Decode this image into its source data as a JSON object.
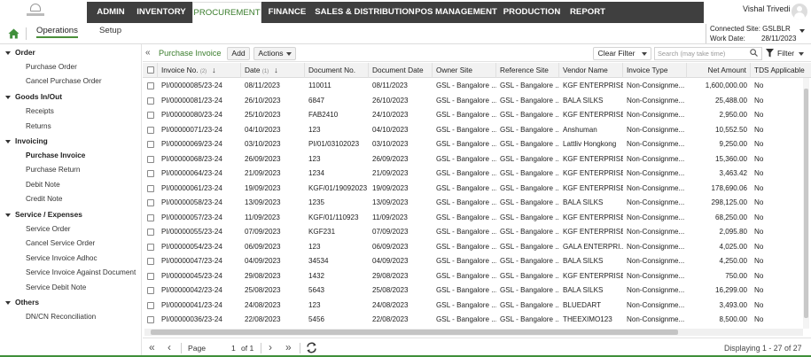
{
  "top_nav": {
    "items": [
      {
        "label": "ADMIN"
      },
      {
        "label": "INVENTORY"
      },
      {
        "label": "PROCUREMENT"
      },
      {
        "label": "FINANCE"
      },
      {
        "label": "SALES & DISTRIBUTION"
      },
      {
        "label": "POS MANAGEMENT"
      },
      {
        "label": "PRODUCTION"
      },
      {
        "label": "REPORT"
      }
    ],
    "active_index": 2,
    "user_name": "Vishal Trivedi"
  },
  "sub_nav": {
    "tabs": [
      {
        "label": "Operations"
      },
      {
        "label": "Setup"
      }
    ],
    "connected_site_label": "Connected Site:",
    "connected_site_value": "GSLBLR",
    "work_date_label": "Work Date:",
    "work_date_value": "28/11/2023"
  },
  "sidebar": {
    "groups": [
      {
        "label": "Order",
        "items": [
          {
            "label": "Purchase Order"
          },
          {
            "label": "Cancel Purchase Order"
          }
        ]
      },
      {
        "label": "Goods In/Out",
        "items": [
          {
            "label": "Receipts"
          },
          {
            "label": "Returns"
          }
        ]
      },
      {
        "label": "Invoicing",
        "items": [
          {
            "label": "Purchase Invoice",
            "active": true
          },
          {
            "label": "Purchase Return"
          },
          {
            "label": "Debit Note"
          },
          {
            "label": "Credit Note"
          }
        ]
      },
      {
        "label": "Service / Expenses",
        "items": [
          {
            "label": "Service Order"
          },
          {
            "label": "Cancel Service Order"
          },
          {
            "label": "Service Invoice Adhoc"
          },
          {
            "label": "Service Invoice Against Document"
          },
          {
            "label": "Service Debit Note"
          }
        ]
      },
      {
        "label": "Others",
        "items": [
          {
            "label": "DN/CN Reconciliation"
          }
        ]
      }
    ]
  },
  "toolbar": {
    "breadcrumb": "Purchase Invoice",
    "add_label": "Add",
    "actions_label": "Actions",
    "clear_filter_label": "Clear Filter",
    "search_placeholder": "Search (may take time)",
    "filter_label": "Filter"
  },
  "grid": {
    "columns": [
      {
        "label": "Invoice No.",
        "suffix": "(2)",
        "sorted": true
      },
      {
        "label": "Date",
        "suffix": "(1)",
        "sorted": true
      },
      {
        "label": "Document No."
      },
      {
        "label": "Document Date"
      },
      {
        "label": "Owner Site"
      },
      {
        "label": "Reference Site"
      },
      {
        "label": "Vendor Name"
      },
      {
        "label": "Invoice Type"
      },
      {
        "label": "Net Amount"
      },
      {
        "label": "TDS Applicable"
      }
    ],
    "rows": [
      [
        "PI/00000085/23-24",
        "08/11/2023",
        "110011",
        "08/11/2023",
        "GSL - Bangalore ...",
        "GSL - Bangalore ...",
        "KGF ENTERPRISES",
        "Non-Consignme...",
        "1,600,000.00",
        "No"
      ],
      [
        "PI/00000081/23-24",
        "26/10/2023",
        "6847",
        "26/10/2023",
        "GSL - Bangalore ...",
        "GSL - Bangalore ...",
        "BALA SILKS",
        "Non-Consignme...",
        "25,488.00",
        "No"
      ],
      [
        "PI/00000080/23-24",
        "25/10/2023",
        "FAB2410",
        "24/10/2023",
        "GSL - Bangalore ...",
        "GSL - Bangalore ...",
        "KGF ENTERPRISES",
        "Non-Consignme...",
        "2,950.00",
        "No"
      ],
      [
        "PI/00000071/23-24",
        "04/10/2023",
        "123",
        "04/10/2023",
        "GSL - Bangalore ...",
        "GSL - Bangalore ...",
        "Anshuman",
        "Non-Consignme...",
        "10,552.50",
        "No"
      ],
      [
        "PI/00000069/23-24",
        "03/10/2023",
        "PI/01/03102023",
        "03/10/2023",
        "GSL - Bangalore ...",
        "GSL - Bangalore ...",
        "Lattliv Hongkong",
        "Non-Consignme...",
        "9,250.00",
        "No"
      ],
      [
        "PI/00000068/23-24",
        "26/09/2023",
        "123",
        "26/09/2023",
        "GSL - Bangalore ...",
        "GSL - Bangalore ...",
        "KGF ENTERPRISES",
        "Non-Consignme...",
        "15,360.00",
        "No"
      ],
      [
        "PI/00000064/23-24",
        "21/09/2023",
        "1234",
        "21/09/2023",
        "GSL - Bangalore ...",
        "GSL - Bangalore ...",
        "KGF ENTERPRISES",
        "Non-Consignme...",
        "3,463.42",
        "No"
      ],
      [
        "PI/00000061/23-24",
        "19/09/2023",
        "KGF/01/19092023",
        "19/09/2023",
        "GSL - Bangalore ...",
        "GSL - Bangalore ...",
        "KGF ENTERPRISES",
        "Non-Consignme...",
        "178,690.06",
        "No"
      ],
      [
        "PI/00000058/23-24",
        "13/09/2023",
        "1235",
        "13/09/2023",
        "GSL - Bangalore ...",
        "GSL - Bangalore ...",
        "BALA SILKS",
        "Non-Consignme...",
        "298,125.00",
        "No"
      ],
      [
        "PI/00000057/23-24",
        "11/09/2023",
        "KGF/01/110923",
        "11/09/2023",
        "GSL - Bangalore ...",
        "GSL - Bangalore ...",
        "KGF ENTERPRISES",
        "Non-Consignme...",
        "68,250.00",
        "No"
      ],
      [
        "PI/00000055/23-24",
        "07/09/2023",
        "KGF231",
        "07/09/2023",
        "GSL - Bangalore ...",
        "GSL - Bangalore ...",
        "KGF ENTERPRISES",
        "Non-Consignme...",
        "2,095.80",
        "No"
      ],
      [
        "PI/00000054/23-24",
        "06/09/2023",
        "123",
        "06/09/2023",
        "GSL - Bangalore ...",
        "GSL - Bangalore ...",
        "GALA ENTERPRI...",
        "Non-Consignme...",
        "4,025.00",
        "No"
      ],
      [
        "PI/00000047/23-24",
        "04/09/2023",
        "34534",
        "04/09/2023",
        "GSL - Bangalore ...",
        "GSL - Bangalore ...",
        "BALA SILKS",
        "Non-Consignme...",
        "4,250.00",
        "No"
      ],
      [
        "PI/00000045/23-24",
        "29/08/2023",
        "1432",
        "29/08/2023",
        "GSL - Bangalore ...",
        "GSL - Bangalore ...",
        "KGF ENTERPRISES",
        "Non-Consignme...",
        "750.00",
        "No"
      ],
      [
        "PI/00000042/23-24",
        "25/08/2023",
        "5643",
        "25/08/2023",
        "GSL - Bangalore ...",
        "GSL - Bangalore ...",
        "BALA SILKS",
        "Non-Consignme...",
        "16,299.00",
        "No"
      ],
      [
        "PI/00000041/23-24",
        "24/08/2023",
        "123",
        "24/08/2023",
        "GSL - Bangalore ...",
        "GSL - Bangalore ...",
        "BLUEDART",
        "Non-Consignme...",
        "3,493.00",
        "No"
      ],
      [
        "PI/00000036/23-24",
        "22/08/2023",
        "5456",
        "22/08/2023",
        "GSL - Bangalore ...",
        "GSL - Bangalore ...",
        "THEEXIMO123",
        "Non-Consignme...",
        "8,500.00",
        "No"
      ]
    ]
  },
  "pager": {
    "page_label": "Page",
    "page_value": "1",
    "of_label": "of 1",
    "display_text": "Displaying 1 - 27 of 27"
  },
  "colors": {
    "accent": "#3a7d2c",
    "nav_bg": "#3f3f3f",
    "bottom_line": "#3f8f3a"
  },
  "icons": [
    "home-icon",
    "collapse-icon",
    "search-icon",
    "filter-icon",
    "sort-down-icon",
    "first-page-icon",
    "prev-page-icon",
    "next-page-icon",
    "last-page-icon",
    "refresh-icon",
    "avatar",
    "chevron-down-icon"
  ]
}
